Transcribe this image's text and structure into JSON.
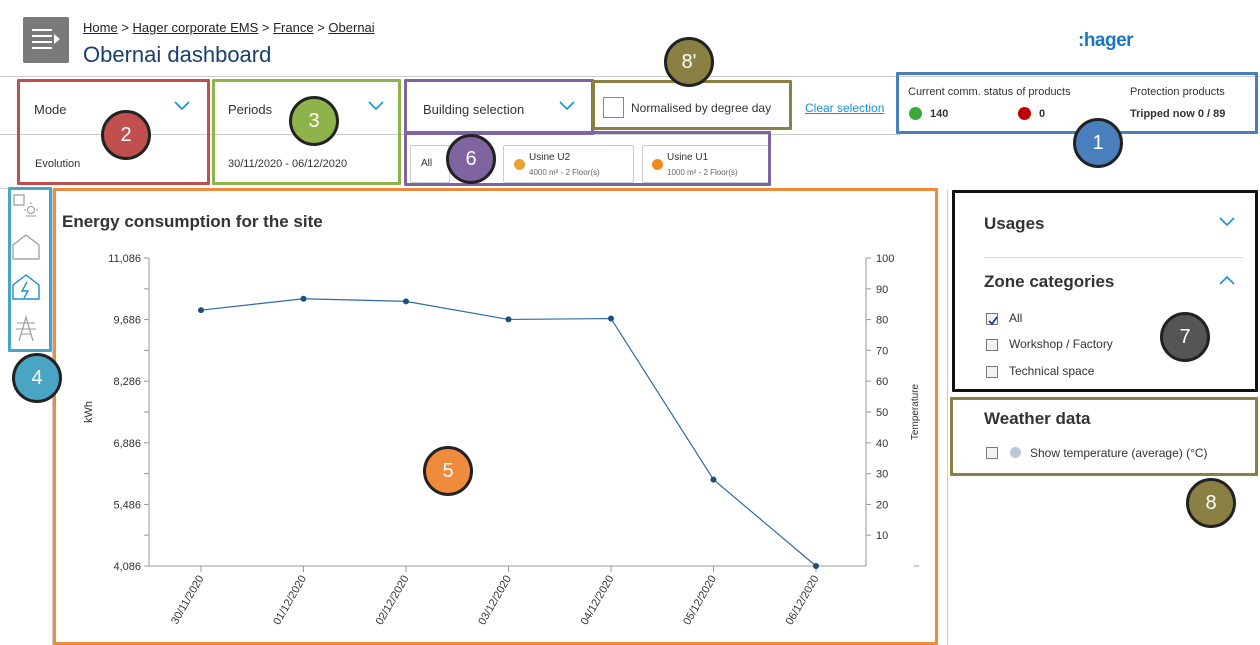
{
  "header": {
    "breadcrumb": [
      "Home",
      "Hager corporate EMS",
      "France",
      "Obernai"
    ],
    "separator": ">",
    "title": "Obernai dashboard",
    "logo": ":hager"
  },
  "filters": {
    "mode": {
      "label": "Mode",
      "value": "Evolution"
    },
    "periods": {
      "label": "Periods",
      "value": "30/11/2020 - 06/12/2020"
    },
    "building": {
      "label": "Building selection",
      "all_label": "All",
      "chips": [
        {
          "name": "Usine U2",
          "detail": "4000 m²  - 2 Floor(s)",
          "color": "#e6a532"
        },
        {
          "name": "Usine U1",
          "detail": "1000 m²  - 2 Floor(s)",
          "color": "#ef8a1e"
        }
      ]
    },
    "normalised_label": "Normalised by degree day",
    "clear_label": "Clear selection"
  },
  "status": {
    "comm_title": "Current comm. status of products",
    "comm_ok": "140",
    "comm_ko": "0",
    "protection_title": "Protection products",
    "tripped_label": "Tripped now",
    "tripped_value": "0 / 89"
  },
  "side_icons": [
    "sensor-light-icon",
    "building-outline-icon",
    "building-energy-icon",
    "power-pylon-icon"
  ],
  "chart": {
    "title": "Energy consumption for the site"
  },
  "chart_data": {
    "type": "line",
    "title": "Energy consumption for the site",
    "x": [
      "30/11/2020",
      "01/12/2020",
      "02/12/2020",
      "03/12/2020",
      "04/12/2020",
      "05/12/2020",
      "06/12/2020"
    ],
    "series": [
      {
        "values": [
          9900,
          10160,
          10100,
          9690,
          9710,
          6050,
          4086
        ]
      }
    ],
    "ylabel": "kWh",
    "y_ticks": [
      "11,086",
      "9,686",
      "8,286",
      "6,886",
      "5,486",
      "4,086"
    ],
    "ylim": [
      4086,
      11086
    ],
    "y2label": "Temperature",
    "y2_ticks": [
      "100",
      "90",
      "80",
      "70",
      "60",
      "50",
      "40",
      "30",
      "20",
      "10"
    ],
    "y2lim": [
      0,
      100
    ],
    "line_color": "#2f6a9e",
    "grid": false
  },
  "panel": {
    "usages_title": "Usages",
    "zone_title": "Zone categories",
    "zones": [
      {
        "label": "All",
        "checked": true
      },
      {
        "label": "Workshop / Factory",
        "checked": false
      },
      {
        "label": "Technical space",
        "checked": false
      }
    ],
    "weather_title": "Weather data",
    "weather_label": "Show temperature (average) (°C)"
  },
  "annotations": [
    {
      "id": "1",
      "color": "#4a7fbf"
    },
    {
      "id": "2",
      "color": "#c0504d"
    },
    {
      "id": "3",
      "color": "#8db34a"
    },
    {
      "id": "4",
      "color": "#4aa5c4"
    },
    {
      "id": "5",
      "color": "#f08a3c"
    },
    {
      "id": "6",
      "color": "#8063a1"
    },
    {
      "id": "7",
      "color": "#555555"
    },
    {
      "id": "8",
      "color": "#8b8044"
    },
    {
      "id": "8'",
      "color": "#8b8044"
    }
  ]
}
